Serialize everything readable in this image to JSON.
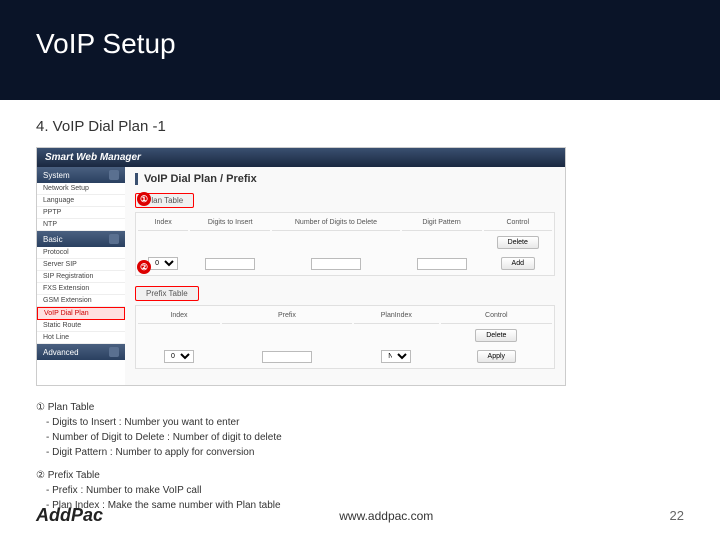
{
  "header": {
    "title": "VoIP Setup"
  },
  "subtitle": "4. VoIP Dial Plan -1",
  "shot": {
    "brand": "Smart Web Manager",
    "side": {
      "system": {
        "label": "System",
        "items": [
          "Network Setup",
          "Language",
          "PPTP",
          "NTP"
        ]
      },
      "basic": {
        "label": "Basic",
        "items": [
          "Protocol",
          "Server SIP",
          "SIP Registration",
          "FXS Extension",
          "GSM Extension"
        ],
        "hl": "VoIP Dial Plan",
        "after": [
          "Static Route",
          "Hot Line"
        ]
      },
      "adv": {
        "label": "Advanced"
      }
    },
    "main": {
      "title": "VoIP Dial Plan / Prefix",
      "plan": {
        "label": "Plan Table",
        "cols": [
          "Index",
          "Digits to Insert",
          "Number of Digits to Delete",
          "Digit Pattern",
          "Control"
        ],
        "idx": "0",
        "del": "Delete",
        "add": "Add"
      },
      "prefix": {
        "label": "Prefix Table",
        "cols": [
          "Index",
          "Prefix",
          "PlanIndex",
          "Control"
        ],
        "idx": "0",
        "plan": "N/A",
        "apply": "Apply"
      }
    }
  },
  "ann": {
    "one": "①",
    "two": "②"
  },
  "notes": {
    "t1": "① Plan Table",
    "d1": "- Digits to Insert : Number you want to enter",
    "d2": "- Number of Digit to Delete : Number of digit to delete",
    "d3": "- Digit Pattern :  Number to apply for conversion",
    "t2": "② Prefix Table",
    "d4": "- Prefix : Number to make VoIP call",
    "d5": "- Plan Index : Make the same number with Plan table"
  },
  "footer": {
    "logo": "AddPac",
    "url": "www.addpac.com",
    "page": "22"
  }
}
